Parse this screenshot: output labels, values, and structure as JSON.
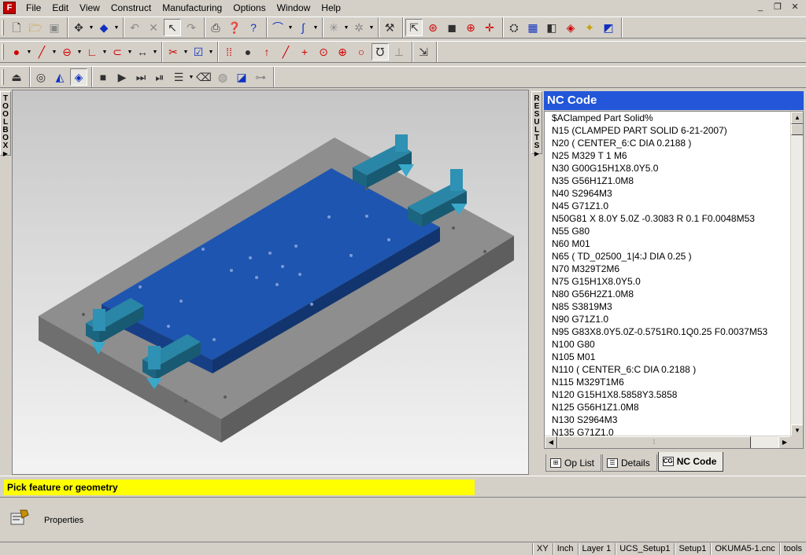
{
  "menubar": {
    "items": [
      "File",
      "Edit",
      "View",
      "Construct",
      "Manufacturing",
      "Options",
      "Window",
      "Help"
    ],
    "logo_letter": "F"
  },
  "window_controls": [
    "_",
    "❐",
    "✕"
  ],
  "toolbox_tab": "TOOLBOX",
  "results_tab": "RESULTS",
  "nc_code": {
    "title": "NC Code",
    "lines": [
      "$AClamped Part Solid%",
      "N15 (CLAMPED PART SOLID  6-21-2007)",
      "N20 ( CENTER_6:C    DIA 0.2188 )",
      "N25 M329 T 1 M6",
      "N30 G00G15H1X8.0Y5.0",
      "N35 G56H1Z1.0M8",
      "N40 S2964M3",
      "N45 G71Z1.0",
      "N50G81 X 8.0Y 5.0Z -0.3083 R 0.1 F0.0048M53",
      "N55 G80",
      "N60 M01",
      "N65 ( TD_02500_1|4:J    DIA 0.25 )",
      "N70 M329T2M6",
      "N75 G15H1X8.0Y5.0",
      "N80 G56H2Z1.0M8",
      "N85 S3819M3",
      "N90 G71Z1.0",
      "N95 G83X8.0Y5.0Z-0.5751R0.1Q0.25 F0.0037M53",
      "N100 G80",
      "N105 M01",
      "N110 ( CENTER_6:C    DIA 0.2188 )",
      "N115 M329T1M6",
      "N120 G15H1X8.5858Y3.5858",
      "N125 G56H1Z1.0M8",
      "N130 S2964M3",
      "N135 G71Z1.0"
    ]
  },
  "result_tabs": [
    {
      "label": "Op List",
      "icon": "op-list-icon",
      "active": false
    },
    {
      "label": "Details",
      "icon": "details-icon",
      "active": false
    },
    {
      "label": "NC Code",
      "icon": "nc-code-icon",
      "active": true
    }
  ],
  "prompt": "Pick feature or geometry",
  "properties": {
    "label": "Properties"
  },
  "statusbar": [
    "XY",
    "Inch",
    "Layer 1",
    "UCS_Setup1",
    "Setup1",
    "OKUMA5-1.cnc",
    "tools"
  ],
  "colors": {
    "nc_header": "#2356d9",
    "prompt_highlight": "#ffff00",
    "part_blue": "#1e55b0",
    "clamp_teal": "#2a86a6",
    "base_gray": "#8e8e8e"
  }
}
